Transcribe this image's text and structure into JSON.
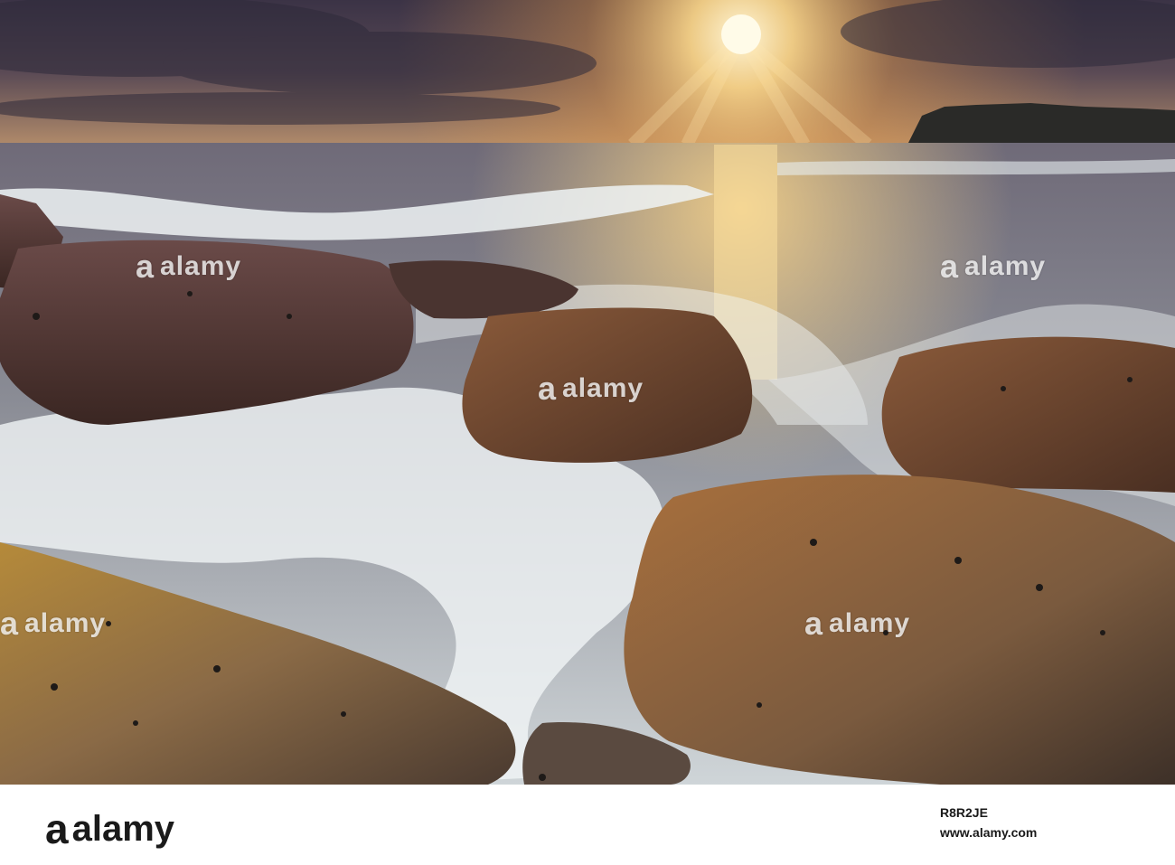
{
  "watermark": {
    "brand": "alamy",
    "brand_mark": "a"
  },
  "footer": {
    "brand": "alamy",
    "brand_mark": "a",
    "image_id": "R8R2JE",
    "url": "www.alamy.com"
  }
}
